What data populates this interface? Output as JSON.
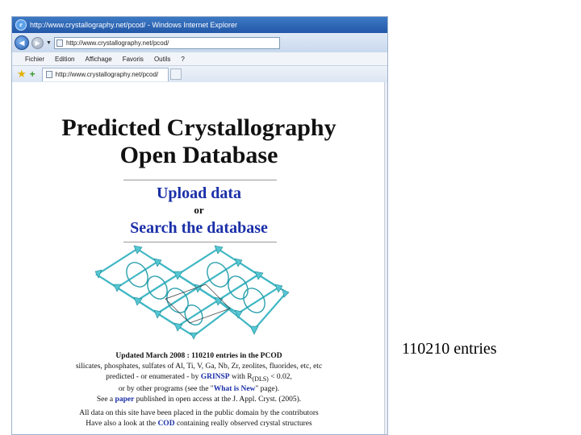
{
  "browser": {
    "window_title": "http://www.crystallography.net/pcod/ - Windows Internet Explorer",
    "address_url": "http://www.crystallography.net/pcod/",
    "menu": [
      "Fichier",
      "Edition",
      "Affichage",
      "Favoris",
      "Outils",
      "?"
    ],
    "tab_label": "http://www.crystallography.net/pcod/"
  },
  "page": {
    "title_line1": "Predicted Crystallography",
    "title_line2": "Open Database",
    "upload_link": "Upload data",
    "or_text": "or",
    "search_link": "Search the database",
    "updated_prefix": "Updated March 2008 : ",
    "updated_count": "110210",
    "updated_suffix": " entries in the PCOD",
    "line2": "silicates, phosphates, sulfates of Al, Ti, V, Ga, Nb, Zr, zeolites, fluorides, etc, etc",
    "line3_prefix": "predicted - or enumerated - by ",
    "grinsp_link": "GRINSP",
    "line3_middle": " with R",
    "line3_subscript": "(DLS)",
    "line3_suffix": " < 0.02,",
    "line4_prefix": "or by other programs (see the \"",
    "whatsnew_link": "What is New",
    "line4_suffix": "\" page).",
    "line5_prefix": "See a ",
    "paper_link": "paper",
    "line5_suffix": " published in open access at the J. Appl. Cryst. (2005).",
    "line6": "All data on this site have been placed in the public domain by the contributors",
    "line7_prefix": "Have also a look at the ",
    "cod_link": "COD",
    "line7_suffix": " containing really observed crystal structures"
  },
  "caption": "110210 entries",
  "colors": {
    "link": "#1a2fa8",
    "titlebar": "#2358a8",
    "crystal": "#3fb7c4"
  },
  "icons": [
    "ie-logo-icon",
    "back-arrow-icon",
    "forward-arrow-icon",
    "page-icon",
    "favorites-star-icon",
    "add-favorite-icon"
  ]
}
